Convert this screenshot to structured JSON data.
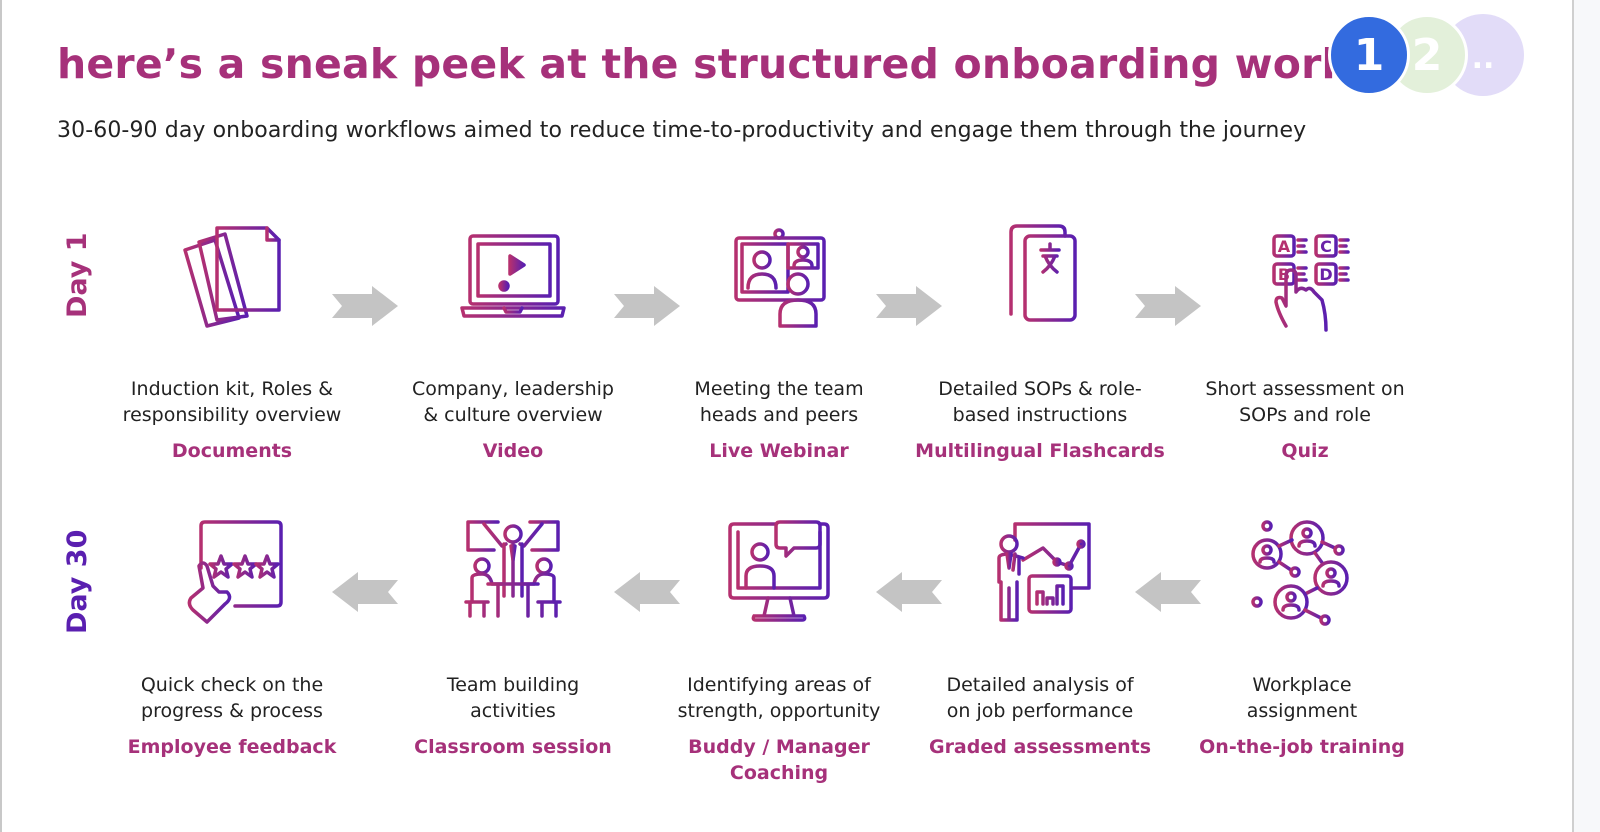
{
  "header": {
    "title": "here’s a sneak peek at the structured onboarding workflow",
    "subtitle": "30-60-90 day onboarding workflows aimed to reduce time-to-productivity and engage them through the journey",
    "badges": [
      "1",
      "2",
      ".."
    ]
  },
  "colors": {
    "title": "#a6317a",
    "day1": "#a6317a",
    "day30": "#5a1fb0",
    "icon_gradient_start": "#b5306f",
    "icon_gradient_end": "#5a1fb0",
    "arrow": "#c4c4c4",
    "badge_1": "#336bdf",
    "badge_2": "#e3f0da",
    "badge_3": "#e2dcf8"
  },
  "rows": [
    {
      "day_label": "Day 1",
      "direction": "right",
      "steps": [
        {
          "icon": "documents-icon",
          "desc_line1": "Induction kit, Roles &",
          "desc_line2": "responsibility overview",
          "kind": "Documents"
        },
        {
          "icon": "video-laptop-icon",
          "desc_line1": "Company, leadership",
          "desc_line2": "& culture overview",
          "kind": "Video"
        },
        {
          "icon": "webinar-icon",
          "desc_line1": "Meeting the team",
          "desc_line2": "heads and peers",
          "kind": "Live Webinar"
        },
        {
          "icon": "flashcards-icon",
          "desc_line1": "Detailed SOPs & role-",
          "desc_line2": "based instructions",
          "kind": "Multilingual Flashcards"
        },
        {
          "icon": "quiz-icon",
          "desc_line1": "Short assessment on",
          "desc_line2": "SOPs and role",
          "kind": "Quiz"
        }
      ]
    },
    {
      "day_label": "Day 30",
      "direction": "left",
      "steps": [
        {
          "icon": "feedback-rating-icon",
          "desc_line1": "Quick check on the",
          "desc_line2": "progress & process",
          "kind": "Employee feedback"
        },
        {
          "icon": "classroom-team-icon",
          "desc_line1": "Team building",
          "desc_line2": "activities",
          "kind": "Classroom session"
        },
        {
          "icon": "coaching-monitor-icon",
          "desc_line1": "Identifying areas of",
          "desc_line2": "strength, opportunity",
          "kind": "Buddy / Manager Coaching"
        },
        {
          "icon": "analysis-presentation-icon",
          "desc_line1": "Detailed analysis of",
          "desc_line2": "on job performance",
          "kind": "Graded assessments"
        },
        {
          "icon": "network-people-icon",
          "desc_line1": "Workplace",
          "desc_line2": "assignment",
          "kind": "On-the-job training"
        }
      ]
    }
  ]
}
